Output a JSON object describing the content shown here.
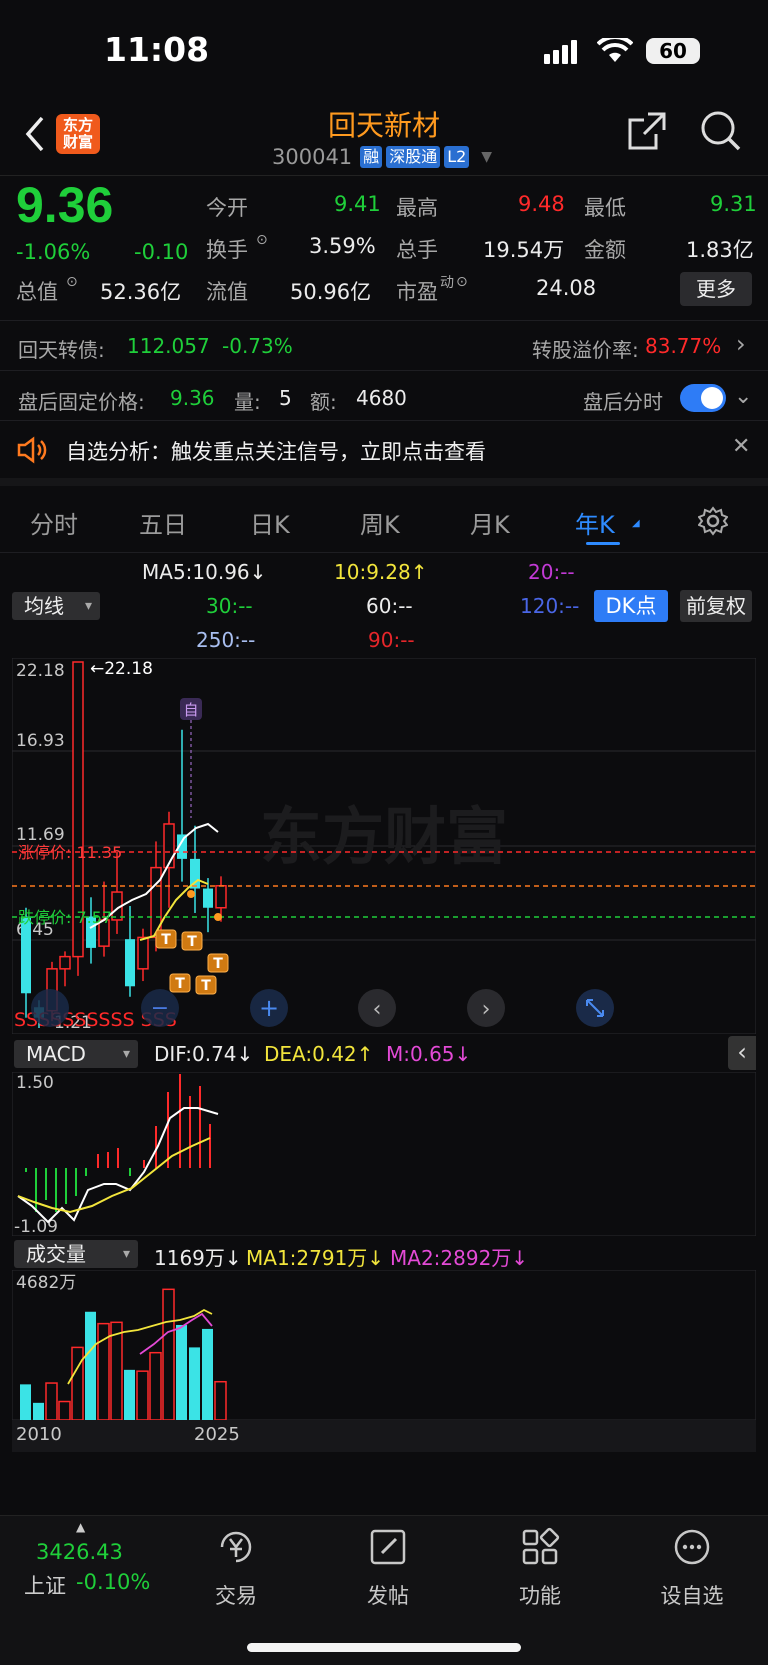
{
  "status": {
    "time": "11:08",
    "battery": "60"
  },
  "header": {
    "name": "回天新材",
    "code": "300041",
    "badges": [
      "融",
      "深股通",
      "L2"
    ],
    "logo_text": "东方财富"
  },
  "quote": {
    "price": "9.36",
    "change_pct": "-1.06%",
    "change": "-0.10",
    "open_label": "今开",
    "open": "9.41",
    "high_label": "最高",
    "high": "9.48",
    "low_label": "最低",
    "low": "9.31",
    "turnover_label": "换手",
    "turnover": "3.59%",
    "volume_label": "总手",
    "volume": "19.54万",
    "amount_label": "金额",
    "amount": "1.83亿",
    "mktcap_label": "总值",
    "mktcap": "52.36亿",
    "float_label": "流值",
    "float": "50.96亿",
    "pe_label": "市盈",
    "pe_sup": "动",
    "pe": "24.08",
    "more": "更多"
  },
  "convertible": {
    "label": "回天转债:",
    "price": "112.057",
    "pct": "-0.73%",
    "premium_label": "转股溢价率:",
    "premium": "83.77%"
  },
  "after_hours": {
    "label": "盘后固定价格:",
    "price": "9.36",
    "vol_label": "量:",
    "vol": "5",
    "amt_label": "额:",
    "amt": "4680",
    "toggle_label": "盘后分时"
  },
  "notice": {
    "text": "自选分析：触发重点关注信号，立即点击查看"
  },
  "tabs": [
    {
      "label": "分时"
    },
    {
      "label": "五日"
    },
    {
      "label": "日K"
    },
    {
      "label": "周K"
    },
    {
      "label": "月K"
    },
    {
      "label": "年K"
    }
  ],
  "ma": {
    "selector": "均线",
    "ma5": "MA5:10.96↓",
    "ma10": "10:9.28↑",
    "ma20": "20:--",
    "ma30": "30:--",
    "ma60": "60:--",
    "ma120": "120:--",
    "ma250": "250:--",
    "ma90": "90:--",
    "dk": "DK点",
    "fq": "前复权"
  },
  "kchart": {
    "y_top": "22.18",
    "y2": "16.93",
    "y3": "11.69",
    "y4": "6.45",
    "y_low": "1.21",
    "high_marker": "←22.18",
    "limit_up": "涨停价: 11.35",
    "limit_down": "跌停价: 7.57",
    "zi": "自",
    "sss": "SSSSSSSSSS SSS",
    "watermark": "东方财富",
    "candles": [
      {
        "o": 3.2,
        "c": 7.6,
        "h": 8.1,
        "l": 1.8,
        "up": false
      },
      {
        "o": 1.8,
        "c": 2.4,
        "h": 2.8,
        "l": 1.21,
        "up": false
      },
      {
        "o": 2.2,
        "c": 4.6,
        "h": 5.0,
        "l": 1.6,
        "up": true
      },
      {
        "o": 4.6,
        "c": 5.3,
        "h": 5.6,
        "l": 3.6,
        "up": true
      },
      {
        "o": 5.3,
        "c": 22.18,
        "h": 22.18,
        "l": 4.2,
        "up": true
      },
      {
        "o": 7.6,
        "c": 5.8,
        "h": 8.7,
        "l": 4.9,
        "up": false
      },
      {
        "o": 5.9,
        "c": 7.4,
        "h": 9.6,
        "l": 5.3,
        "up": true
      },
      {
        "o": 7.4,
        "c": 9.0,
        "h": 11.3,
        "l": 6.6,
        "up": true
      },
      {
        "o": 6.3,
        "c": 3.6,
        "h": 8.2,
        "l": 3.0,
        "up": false
      },
      {
        "o": 4.6,
        "c": 6.4,
        "h": 6.9,
        "l": 3.9,
        "up": true
      },
      {
        "o": 6.4,
        "c": 10.4,
        "h": 11.9,
        "l": 5.6,
        "up": true
      },
      {
        "o": 10.4,
        "c": 12.9,
        "h": 13.6,
        "l": 8.1,
        "up": true
      },
      {
        "o": 12.3,
        "c": 10.9,
        "h": 18.3,
        "l": 9.6,
        "up": false
      },
      {
        "o": 10.9,
        "c": 9.2,
        "h": 12.8,
        "l": 7.8,
        "up": false
      },
      {
        "o": 9.2,
        "c": 8.1,
        "h": 9.8,
        "l": 6.7,
        "up": false
      },
      {
        "o": 8.1,
        "c": 9.36,
        "h": 9.9,
        "l": 7.3,
        "up": true
      }
    ]
  },
  "macd": {
    "selector": "MACD",
    "dif": "DIF:0.74↓",
    "dea": "DEA:0.42↑",
    "m": "M:0.65↓",
    "top": "1.50",
    "bottom": "-1.09"
  },
  "volume": {
    "selector": "成交量",
    "v": "1169万↓",
    "ma1": "MA1:2791万↓",
    "ma2": "MA2:2892万↓",
    "top": "4682万",
    "x_start": "2010",
    "x_end": "2025",
    "bars": [
      0.27,
      0.13,
      0.28,
      0.14,
      0.55,
      0.82,
      0.73,
      0.74,
      0.38,
      0.37,
      0.51,
      0.99,
      0.72,
      0.55,
      0.69,
      0.29
    ]
  },
  "bottom_nav": {
    "index_value": "3426.43",
    "index_name": "上证",
    "index_pct": "-0.10%",
    "trade": "交易",
    "post": "发帖",
    "func": "功能",
    "watch": "设自选"
  }
}
